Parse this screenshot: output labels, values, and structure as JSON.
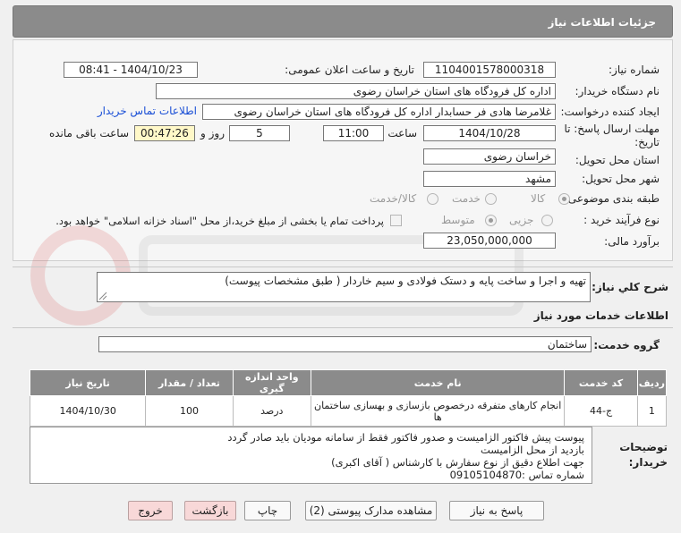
{
  "header": {
    "title": "جزئیات اطلاعات نیاز"
  },
  "form": {
    "need_number_label": "شماره نیاز:",
    "need_number": "1104001578000318",
    "announce_label": "تاریخ و ساعت اعلان عمومی:",
    "announce_value": "1404/10/23 - 08:41",
    "buyer_org_label": "نام دستگاه خریدار:",
    "buyer_org": "اداره کل فرودگاه های استان خراسان رضوی",
    "creator_label": "ایجاد کننده درخواست:",
    "creator": "غلامرضا هادی فر حسابدار اداره کل فرودگاه های استان خراسان رضوی",
    "contact_link": "اطلاعات تماس خریدار",
    "deadline_label_line1": "مهلت ارسال پاسخ: تا",
    "deadline_label_line2": "تاریخ:",
    "deadline_date": "1404/10/28",
    "time_label": "ساعت",
    "deadline_time": "11:00",
    "days_value": "5",
    "days_label": "روز و",
    "remaining_time": "00:47:26",
    "remaining_label": "ساعت باقی مانده",
    "province_label": "استان محل تحویل:",
    "province": "خراسان رضوی",
    "city_label": "شهر محل تحویل:",
    "city": "مشهد",
    "category_label": "طبقه بندی موضوعی:",
    "category_options": [
      "کالا",
      "خدمت",
      "کالا/خدمت"
    ],
    "process_label": "نوع فرآیند خرید :",
    "process_options": [
      "جزیی",
      "متوسط"
    ],
    "payment_note": "پرداخت تمام یا بخشی از مبلغ خرید،از محل \"اسناد خزانه اسلامی\" خواهد بود.",
    "estimate_label": "برآورد مالی:",
    "estimate": "23,050,000,000"
  },
  "summary": {
    "label": "شرح کلي نياز:",
    "text": "تهیه و اجرا و ساخت پایه و دستک فولادی و سیم خاردار ( طبق مشخصات پیوست)"
  },
  "services": {
    "section_title": "اطلاعات خدمات مورد نیاز",
    "group_label": "گروه خدمت:",
    "group_value": "ساختمان",
    "columns": [
      "ردیف",
      "کد خدمت",
      "نام خدمت",
      "واحد اندازه گیری",
      "تعداد / مقدار",
      "تاریخ نیاز"
    ],
    "rows": [
      {
        "index": "1",
        "code": "ج-44",
        "name_line1": "انجام کارهای متفرقه درخصوص بازسازی و بهسازی ساختمان",
        "name_line2": "ها",
        "unit": "درصد",
        "qty": "100",
        "date": "1404/10/30"
      }
    ]
  },
  "buyer_notes": {
    "label_line1": "توضیحات",
    "label_line2": "خریدار:",
    "lines": [
      "پیوست پیش فاکتور الزامیست و صدور فاکتور فقط از سامانه مودیان باید صادر گردد",
      "بازدید از محل الزامیست",
      "جهت اطلاع دقیق از نوع سفارش با کارشناس   ( آقای اکبری)",
      "شماره تماس :09105104870"
    ]
  },
  "buttons": {
    "reply": "پاسخ به نیاز",
    "attachments": "مشاهده مدارک پیوستی (2)",
    "print": "چاپ",
    "back": "بازگشت",
    "exit": "خروج"
  },
  "colors": {
    "header_bg": "#8b8b8b",
    "link": "#1a4fd6",
    "remaining_bg": "#fff8c8",
    "exit_bg": "#f8d8d8"
  }
}
